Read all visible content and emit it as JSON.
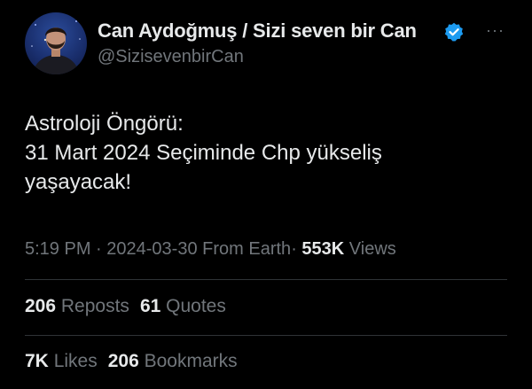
{
  "author": {
    "display_name": "Can Aydoğmuş / Sizi seven bir Can",
    "handle": "@SizisevenbirCan",
    "verified_icon": "verified-badge-icon",
    "verified_color": "#1d9bf0"
  },
  "menu": {
    "more_label": "···"
  },
  "tweet": {
    "lines": [
      "Astroloji Öngörü:",
      "31 Mart 2024 Seçiminde Chp yükseliş",
      "yaşayacak!"
    ]
  },
  "meta": {
    "time": "5:19 PM",
    "date": "2024-03-30",
    "source": "From Earth",
    "separator": "·",
    "views_count": "553K",
    "views_label": "Views"
  },
  "engagement": {
    "reposts_count": "206",
    "reposts_label": "Reposts",
    "quotes_count": "61",
    "quotes_label": "Quotes",
    "likes_count": "7K",
    "likes_label": "Likes",
    "bookmarks_count": "206",
    "bookmarks_label": "Bookmarks"
  },
  "colors": {
    "background": "#000000",
    "text_primary": "#e7e9ea",
    "text_secondary": "#71767b",
    "divider": "#2f3336"
  }
}
